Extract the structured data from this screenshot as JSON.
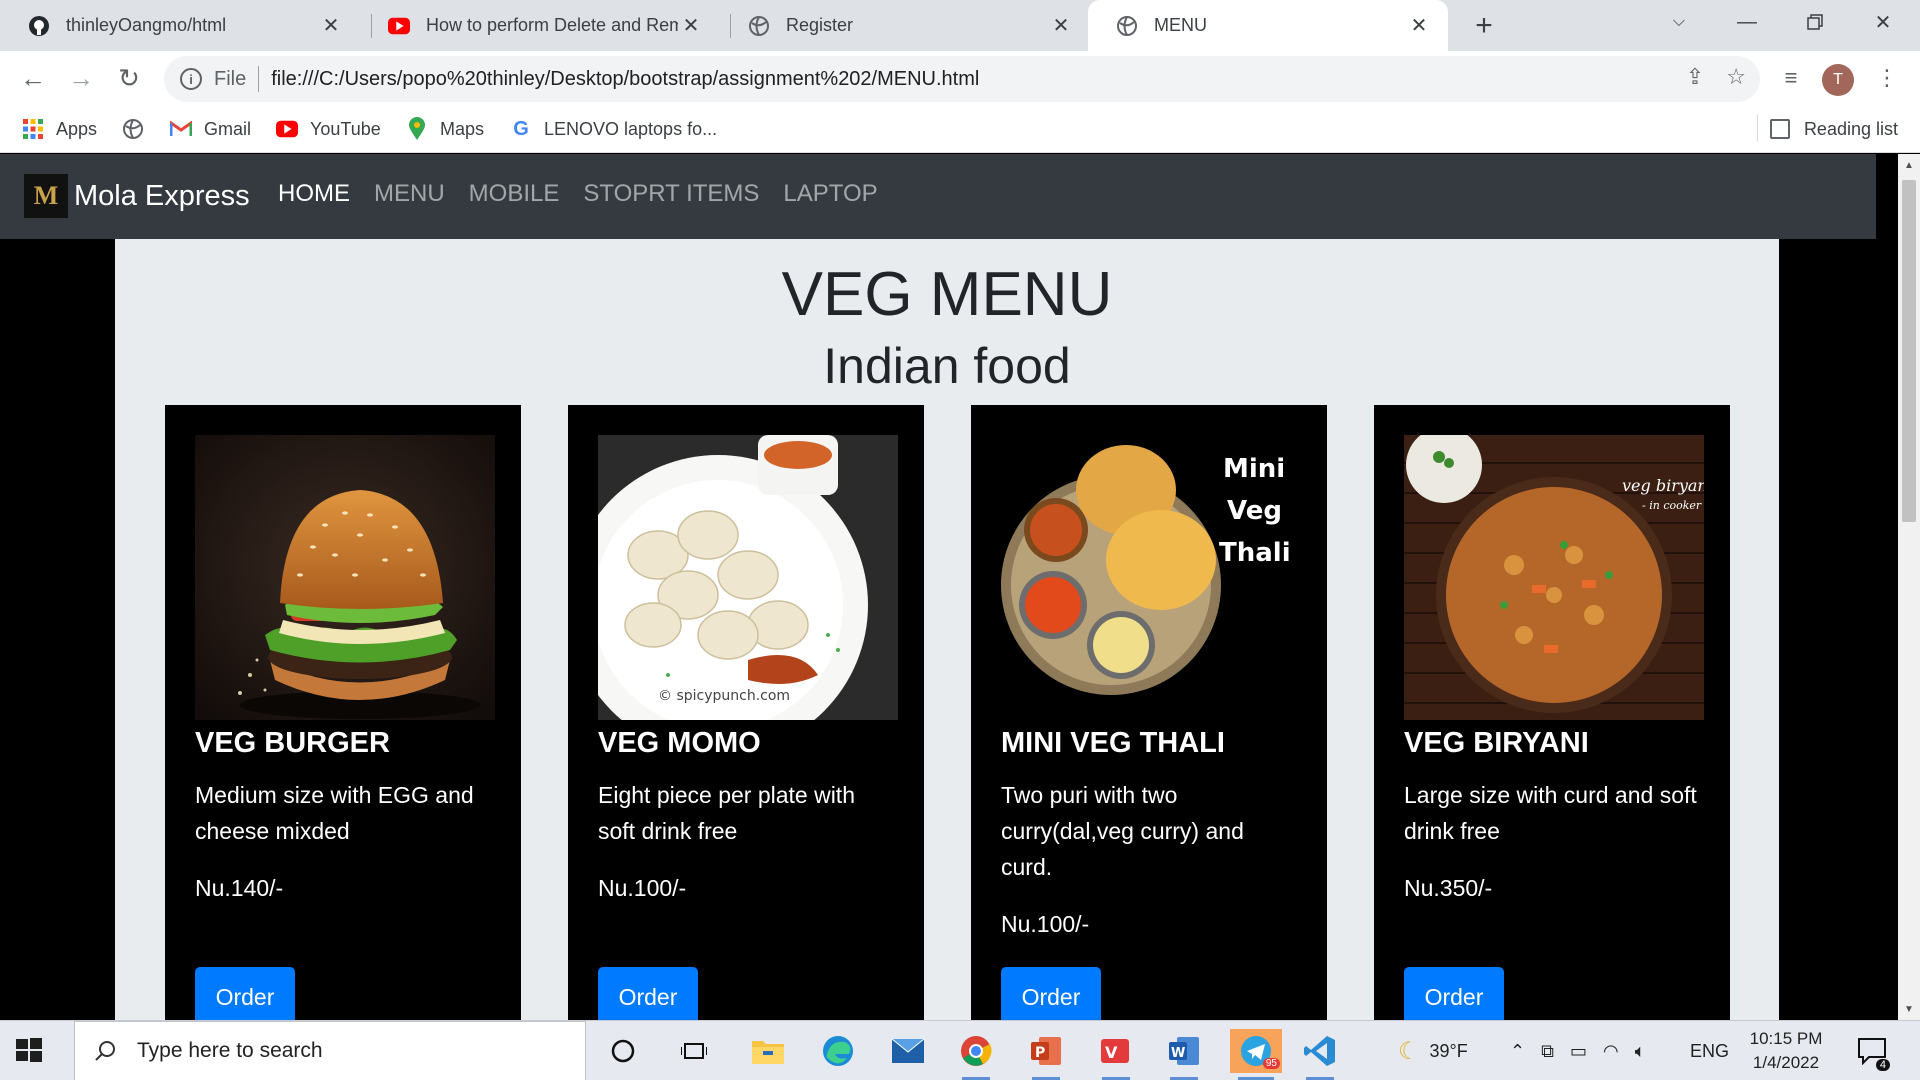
{
  "browser": {
    "tabs": [
      {
        "title": "thinleyOangmo/html",
        "icon": "github-icon",
        "active": false
      },
      {
        "title": "How to perform Delete and Remo",
        "icon": "youtube-icon",
        "active": false
      },
      {
        "title": "Register",
        "icon": "globe-icon",
        "active": false
      },
      {
        "title": "MENU",
        "icon": "globe-icon",
        "active": true
      }
    ],
    "url_scheme_label": "File",
    "url": "file:///C:/Users/popo%20thinley/Desktop/bootstrap/assignment%202/MENU.html",
    "profile_initial": "T",
    "bookmarks": [
      {
        "label": "Apps",
        "icon": "apps-grid-icon"
      },
      {
        "label": "",
        "icon": "globe-icon"
      },
      {
        "label": "Gmail",
        "icon": "gmail-icon"
      },
      {
        "label": "YouTube",
        "icon": "youtube-icon"
      },
      {
        "label": "Maps",
        "icon": "maps-pin-icon"
      },
      {
        "label": "LENOVO laptops fo...",
        "icon": "google-icon"
      }
    ],
    "reading_list_label": "Reading list"
  },
  "site": {
    "brand_logo_letter": "M",
    "brand_name": "Mola Express",
    "nav": [
      {
        "label": "HOME",
        "active": true
      },
      {
        "label": "MENU",
        "active": false
      },
      {
        "label": "MOBILE",
        "active": false
      },
      {
        "label": "STOPRT ITEMS",
        "active": false
      },
      {
        "label": "LAPTOP",
        "active": false
      }
    ],
    "heading": "VEG MENU",
    "subheading": "Indian food",
    "cards": [
      {
        "title": "VEG BURGER",
        "description": "Medium size with EGG and cheese mixded",
        "price": "Nu.140/-",
        "button": "Order",
        "image_label": ""
      },
      {
        "title": "VEG MOMO",
        "description": "Eight piece per plate with soft drink free",
        "price": "Nu.100/-",
        "button": "Order",
        "image_label": "© spicypunch.com"
      },
      {
        "title": "MINI VEG THALI",
        "description": "Two puri with two curry(dal,veg curry) and curd.",
        "price": "Nu.100/-",
        "button": "Order",
        "image_label": "Mini Veg Thali"
      },
      {
        "title": "VEG BIRYANI",
        "description": "Large size with curd and soft drink free",
        "price": "Nu.350/-",
        "button": "Order",
        "image_label": "veg biryani - in cooker"
      }
    ]
  },
  "taskbar": {
    "search_placeholder": "Type here to search",
    "weather": "39°F",
    "language": "ENG",
    "time": "10:15 PM",
    "date": "1/4/2022",
    "notification_count": "4",
    "telegram_badge": "95"
  },
  "colors": {
    "site_nav_bg": "#343a40",
    "content_bg": "#e9ecef",
    "card_bg": "#000000",
    "button_blue": "#007bff"
  }
}
